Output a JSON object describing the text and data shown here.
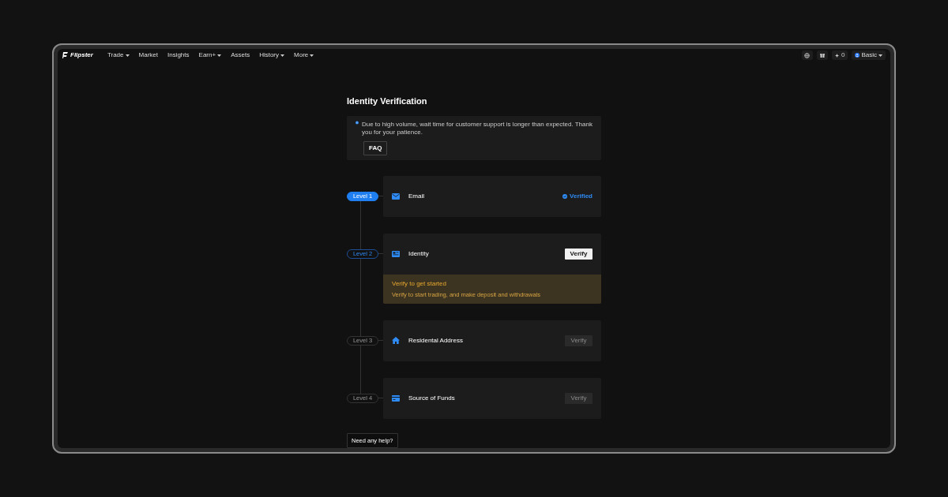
{
  "nav": {
    "logo": "Flipster",
    "items": [
      {
        "label": "Trade",
        "has_menu": true
      },
      {
        "label": "Market",
        "has_menu": false
      },
      {
        "label": "Insights",
        "has_menu": false
      },
      {
        "label": "Earn+",
        "has_menu": true
      },
      {
        "label": "Assets",
        "has_menu": false
      },
      {
        "label": "History",
        "has_menu": true
      },
      {
        "label": "More",
        "has_menu": true
      }
    ],
    "points": "0",
    "account": "Basic"
  },
  "title": "Identity Verification",
  "notice": {
    "text": "Due to high volume, wait time for customer support is longer than expected. Thank you for your patience.",
    "button": "FAQ"
  },
  "levels": [
    {
      "level": "Level 1",
      "done": true,
      "active": false,
      "kind": "email",
      "name": "Email",
      "verified": "Verified"
    },
    {
      "level": "Level 2",
      "done": false,
      "active": true,
      "kind": "identity",
      "name": "Identity",
      "button": "Verify",
      "disabled": false,
      "warning_title": "Verify to get started",
      "warning_text": "Verify to start trading, and make deposit and withdrawals"
    },
    {
      "level": "Level 3",
      "done": false,
      "active": false,
      "kind": "address",
      "name": "Residental Address",
      "button": "Verify",
      "disabled": true
    },
    {
      "level": "Level 4",
      "done": false,
      "active": false,
      "kind": "funds",
      "name": "Source of Funds",
      "button": "Verify",
      "disabled": true
    }
  ],
  "help": "Need any help?"
}
